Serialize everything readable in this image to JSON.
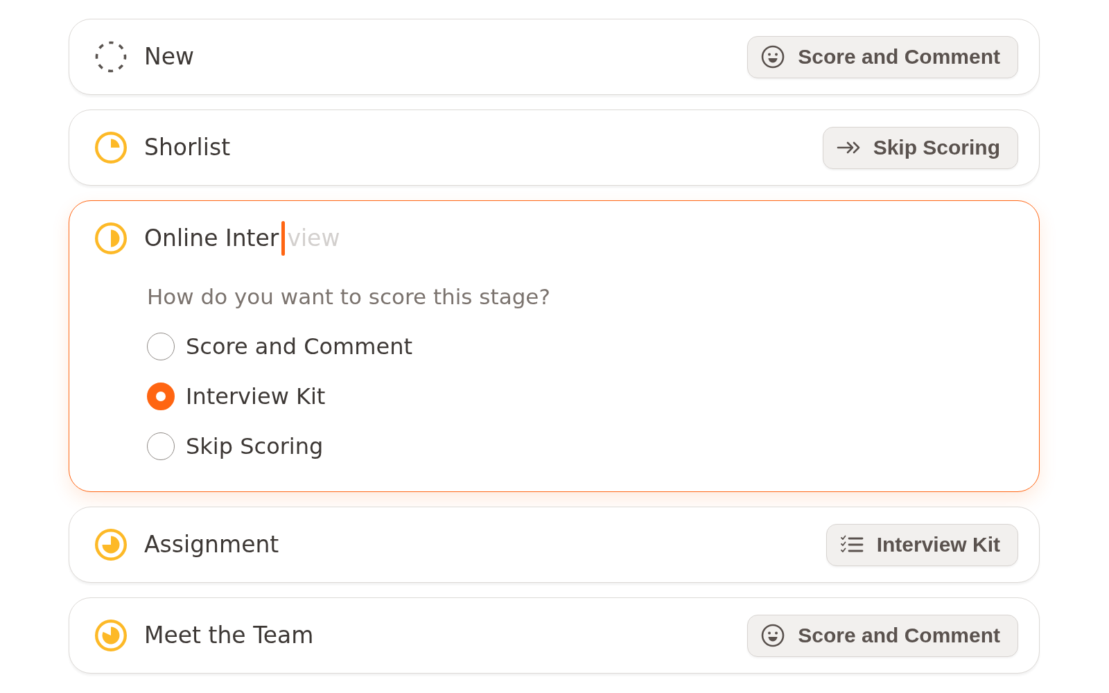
{
  "stages": [
    {
      "title": "New",
      "kind": "new",
      "expanded": false,
      "action": {
        "kind": "score",
        "label": "Score and Comment"
      }
    },
    {
      "title": "Shorlist",
      "kind": "quarter",
      "expanded": false,
      "action": {
        "kind": "skip",
        "label": "Skip Scoring"
      }
    },
    {
      "title": "Online Inter",
      "suggestion": "view",
      "kind": "half",
      "expanded": true,
      "question": "How do you want to score this stage?",
      "options": [
        {
          "label": "Score and Comment",
          "selected": false
        },
        {
          "label": "Interview Kit",
          "selected": true
        },
        {
          "label": "Skip Scoring",
          "selected": false
        }
      ]
    },
    {
      "title": "Assignment",
      "kind": "threequarters",
      "expanded": false,
      "action": {
        "kind": "kit",
        "label": "Interview Kit"
      }
    },
    {
      "title": "Meet the Team",
      "kind": "nearlyfull",
      "expanded": false,
      "action": {
        "kind": "score",
        "label": "Score and Comment"
      }
    }
  ]
}
